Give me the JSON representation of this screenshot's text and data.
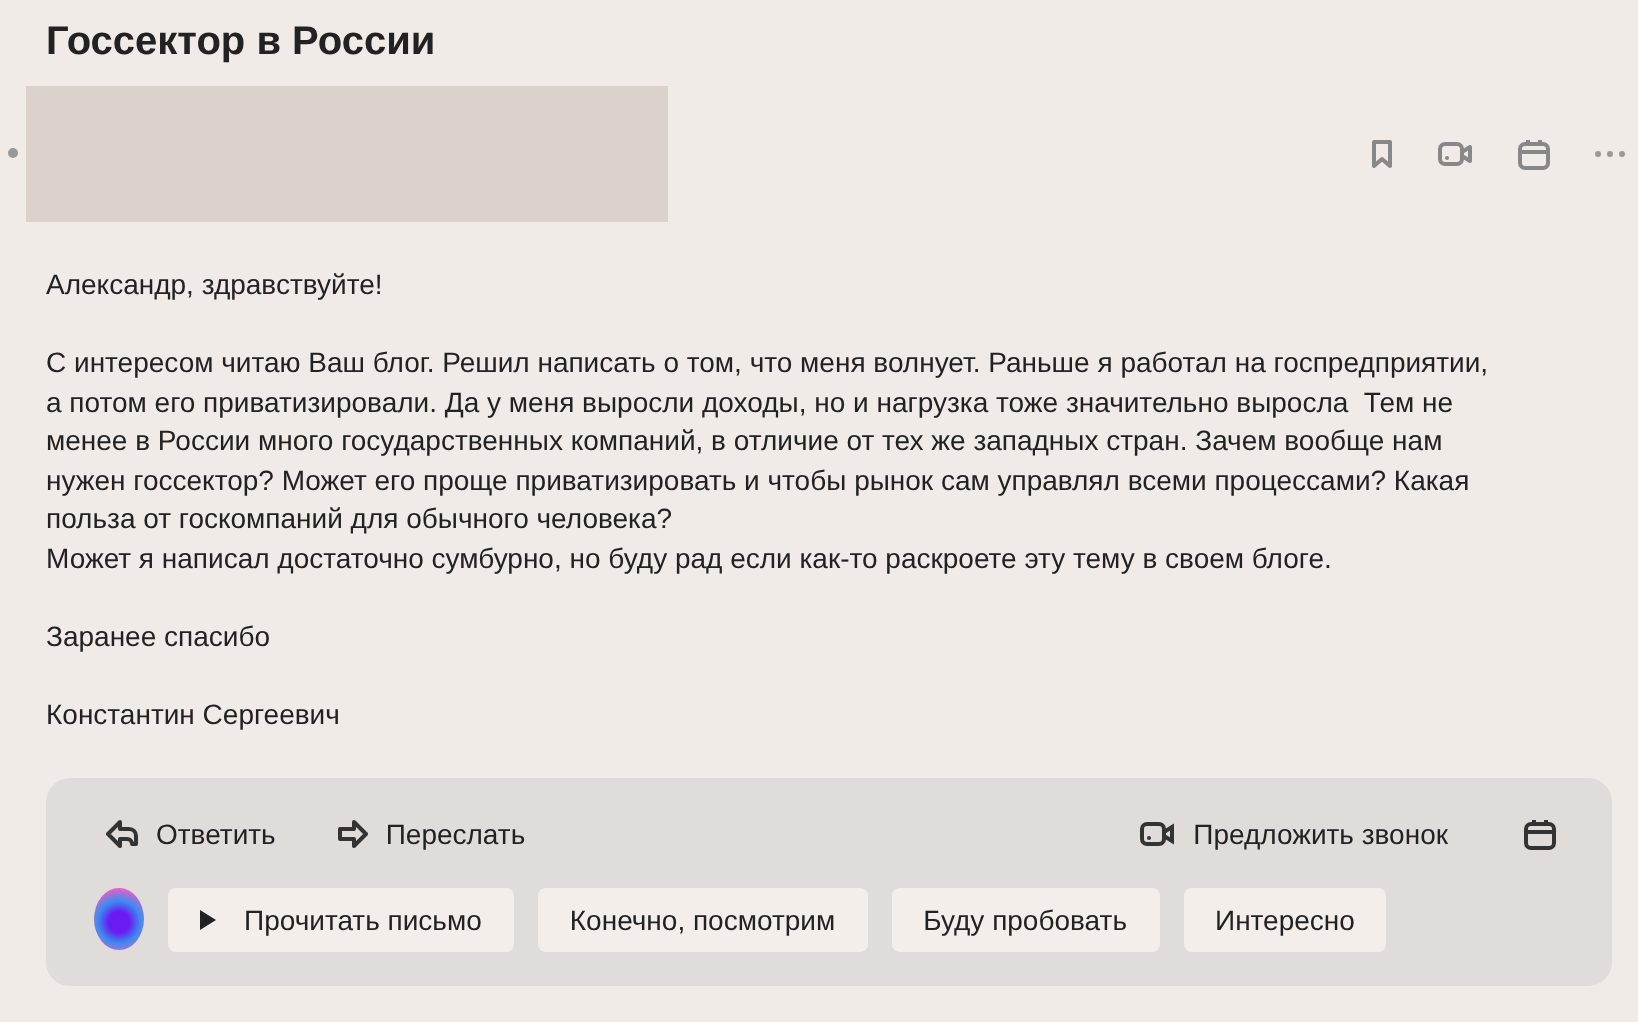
{
  "title": "Госсектор в России",
  "body": [
    {
      "lines": [
        "Александр, здравствуйте!"
      ]
    },
    {
      "lines": [
        "С интересом читаю Ваш блог. Решил написать о том, что меня волнует. Раньше я работал на госпредприятии,",
        "а потом его приватизировали. Да у меня выросли доходы, но и нагрузка тоже значительно выросла  Тем не",
        "менее в России много государственных компаний, в отличие от тех же западных стран. Зачем вообще нам",
        "нужен госсектор? Может его проще приватизировать и чтобы рынок сам управлял всеми процессами? Какая",
        "польза от госкомпаний для обычного человека?",
        "Может я написал достаточно сумбурно, но буду рад если как-то раскроете эту тему в своем блоге."
      ]
    },
    {
      "lines": [
        "Заранее спасибо"
      ]
    },
    {
      "lines": [
        "Константин Сергеевич"
      ]
    }
  ],
  "actions": [
    {
      "label": "Ответить",
      "kind": "reply"
    },
    {
      "label": "Переслать",
      "kind": "forward"
    }
  ],
  "call_action": {
    "label": "Предложить звонок"
  },
  "quick_replies": [
    {
      "label": "Прочитать письмо",
      "kind": "play"
    },
    {
      "label": "Конечно, посмотрим",
      "kind": "text"
    },
    {
      "label": "Буду пробовать",
      "kind": "text"
    },
    {
      "label": "Интересно",
      "kind": "text"
    }
  ]
}
